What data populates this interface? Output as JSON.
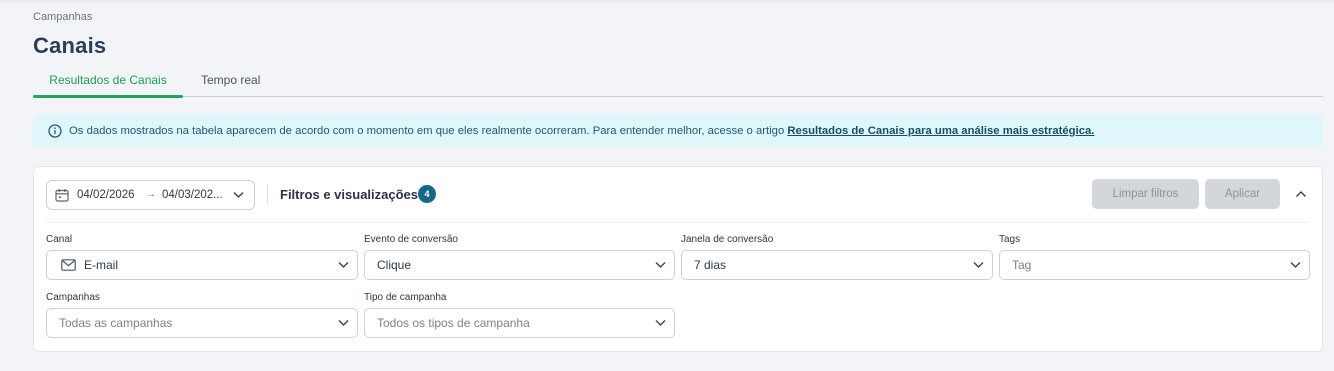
{
  "breadcrumb": "Campanhas",
  "page_title": "Canais",
  "tabs": [
    {
      "label": "Resultados de Canais",
      "active": true
    },
    {
      "label": "Tempo real",
      "active": false
    }
  ],
  "info": {
    "icon": "info-circle-icon",
    "text": "Os dados mostrados na tabela aparecem de acordo com o momento em que eles realmente ocorreram. Para entender melhor, acesse o artigo ",
    "link": "Resultados de Canais para uma análise mais estratégica."
  },
  "filters": {
    "date_start": "04/02/2026",
    "date_arrow": "→",
    "date_end": "04/03/202...",
    "title": "Filtros e visualizações",
    "count": "4",
    "clear_label": "Limpar filtros",
    "apply_label": "Aplicar",
    "fields": {
      "canal": {
        "label": "Canal",
        "value": "E-mail",
        "icon": "mail-icon"
      },
      "evento": {
        "label": "Evento de conversão",
        "value": "Clique"
      },
      "janela": {
        "label": "Janela de conversão",
        "value": "7 dias"
      },
      "tags": {
        "label": "Tags",
        "placeholder": "Tag"
      },
      "campanhas": {
        "label": "Campanhas",
        "placeholder": "Todas as campanhas"
      },
      "tipo": {
        "label": "Tipo de campanha",
        "placeholder": "Todos os tipos de campanha"
      }
    }
  },
  "colors": {
    "accent_green": "#22a45d",
    "title_blue": "#2b3d5b",
    "badge": "#14698a",
    "info_bg": "#dff6fb",
    "info_text": "#1c5b73"
  }
}
